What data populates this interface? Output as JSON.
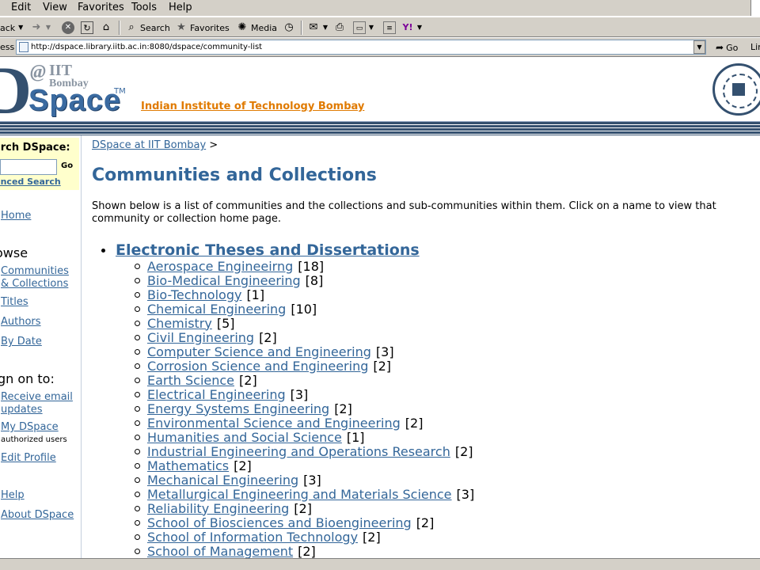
{
  "browser": {
    "menu": [
      "Edit",
      "View",
      "Favorites",
      "Tools",
      "Help"
    ],
    "toolbar": {
      "back_label": "ack",
      "search_label": "Search",
      "favorites_label": "Favorites",
      "media_label": "Media"
    },
    "address": {
      "label": "ess",
      "url": "http://dspace.library.iitb.ac.in:8080/dspace/community-list",
      "go_label": "Go",
      "links_label": "Lin"
    }
  },
  "header": {
    "logo": {
      "at": "@",
      "iit": "IIT",
      "bombay": "Bombay",
      "space": "Space",
      "tm": "TM"
    },
    "institute_link": "Indian Institute of Technology Bombay"
  },
  "sidebar": {
    "search_title": "arch DSpace:",
    "go_label": "Go",
    "advanced_search": "vanced Search",
    "home": "Home",
    "browse_heading": "owse",
    "browse_items": [
      "Communities",
      "& Collections",
      "Titles",
      "Authors",
      "By Date"
    ],
    "signon_heading": "gn on to:",
    "signon_items": [
      "Receive email",
      "updates",
      "My DSpace"
    ],
    "authorized_users": "authorized users",
    "edit_profile": "Edit Profile",
    "help": "Help",
    "about": "About DSpace"
  },
  "main": {
    "breadcrumb_link": "DSpace at IIT Bombay",
    "breadcrumb_sep": ">",
    "title": "Communities and Collections",
    "intro": "Shown below is a list of communities and the collections and sub-communities within them. Click on a name to view that community or collection home page.",
    "community": "Electronic Theses and Dissertations",
    "collections": [
      {
        "name": "Aerospace Engineeirng",
        "count": "[18]"
      },
      {
        "name": "Bio-Medical Engineering",
        "count": "[8]"
      },
      {
        "name": "Bio-Technology",
        "count": "[1]"
      },
      {
        "name": "Chemical Engineering",
        "count": "[10]"
      },
      {
        "name": "Chemistry",
        "count": "[5]"
      },
      {
        "name": "Civil Engineering",
        "count": "[2]"
      },
      {
        "name": "Computer Science and Engineering",
        "count": "[3]"
      },
      {
        "name": "Corrosion Science and Engineering",
        "count": "[2]"
      },
      {
        "name": "Earth Science",
        "count": "[2]"
      },
      {
        "name": "Electrical Engineering",
        "count": "[3]"
      },
      {
        "name": "Energy Systems Engineering",
        "count": "[2]"
      },
      {
        "name": "Environmental Science and Engineering",
        "count": "[2]"
      },
      {
        "name": "Humanities and Social Science",
        "count": "[1]"
      },
      {
        "name": "Industrial Engineering and Operations Research",
        "count": "[2]"
      },
      {
        "name": "Mathematics",
        "count": "[2]"
      },
      {
        "name": "Mechanical Engineering",
        "count": "[3]"
      },
      {
        "name": "Metallurgical Engineering and Materials Science",
        "count": "[3]"
      },
      {
        "name": "Reliability Engineering",
        "count": "[2]"
      },
      {
        "name": "School of Biosciences and Bioengineering",
        "count": "[2]"
      },
      {
        "name": "School of Information Technology",
        "count": "[2]"
      },
      {
        "name": "School of Management",
        "count": "[2]"
      }
    ]
  },
  "colors": {
    "link": "#336699",
    "institute_link": "#e07a00",
    "header_dark": "#34506f",
    "search_box_bg": "#ffffcc",
    "chrome": "#d4d0c8"
  }
}
